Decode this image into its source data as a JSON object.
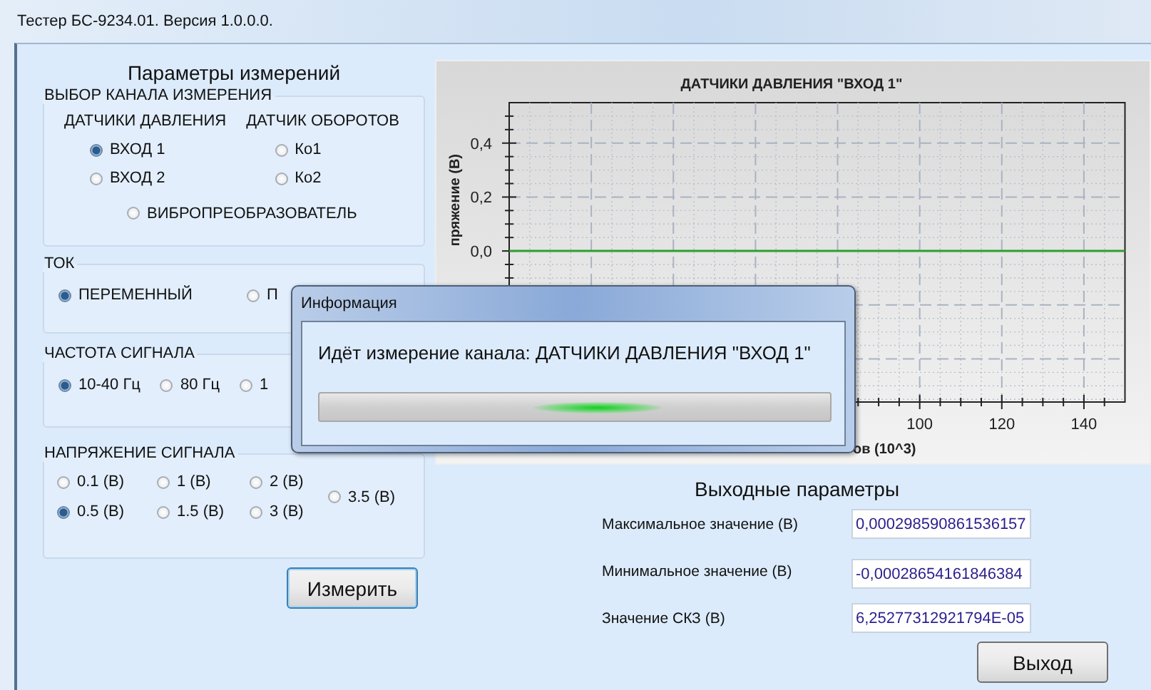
{
  "window": {
    "title": "Тестер БС-9234.01. Версия 1.0.0.0."
  },
  "parameters": {
    "heading": "Параметры измерений",
    "channel": {
      "legend": "ВЫБОР КАНАЛА ИЗМЕРЕНИЯ",
      "columns": [
        {
          "heading": "ДАТЧИКИ ДАВЛЕНИЯ",
          "options": [
            {
              "label": "ВХОД 1",
              "selected": true
            },
            {
              "label": "ВХОД 2",
              "selected": false
            }
          ]
        },
        {
          "heading": "ДАТЧИК ОБОРОТОВ",
          "options": [
            {
              "label": "Ко1",
              "selected": false
            },
            {
              "label": "Ко2",
              "selected": false
            }
          ]
        }
      ],
      "extra": {
        "label": "ВИБРОПРЕОБРАЗОВАТЕЛЬ",
        "selected": false
      }
    },
    "current": {
      "legend": "ТОК",
      "options": [
        {
          "label": "ПЕРЕМЕННЫЙ",
          "selected": true
        },
        {
          "label": "П",
          "selected": false
        }
      ]
    },
    "frequency": {
      "legend": "ЧАСТОТА СИГНАЛА",
      "options": [
        {
          "label": "10-40 Гц",
          "selected": true
        },
        {
          "label": "80 Гц",
          "selected": false
        },
        {
          "label": "1",
          "selected": false
        }
      ]
    },
    "voltage": {
      "legend": "НАПРЯЖЕНИЕ СИГНАЛА",
      "options": [
        {
          "label": "0.1 (В)",
          "selected": false
        },
        {
          "label": "1 (В)",
          "selected": false
        },
        {
          "label": "2 (В)",
          "selected": false
        },
        {
          "label": "3.5 (В)",
          "selected": false
        },
        {
          "label": "0.5 (В)",
          "selected": true
        },
        {
          "label": "1.5 (В)",
          "selected": false
        },
        {
          "label": "3 (В)",
          "selected": false
        }
      ]
    },
    "measure_button": "Измерить"
  },
  "chart": {
    "chart_data": {
      "type": "line",
      "title": "ДАТЧИКИ ДАВЛЕНИЯ \"ВХОД 1\"",
      "xlabel": "ов (10^3)",
      "ylabel": "пряжение (В)",
      "x": [
        0,
        150
      ],
      "series": [
        {
          "color": "#2ca02c",
          "values": [
            0,
            0
          ]
        }
      ],
      "grid": true,
      "xlim": [
        0,
        150
      ],
      "ylim": [
        -0.56,
        0.55
      ],
      "xticks": [
        100,
        120,
        140
      ],
      "yticks": [
        {
          "value": 0,
          "label": "0,0"
        },
        {
          "value": 0.2,
          "label": "0,2"
        },
        {
          "value": 0.4,
          "label": "0,4"
        }
      ]
    }
  },
  "output": {
    "heading": "Выходные параметры",
    "fields": [
      {
        "label": "Максимальное значение (В)",
        "value": "0,000298590861536157"
      },
      {
        "label": "Минимальное значение (В)",
        "value": "-0,00028654161846384"
      },
      {
        "label": "Значение СКЗ (В)",
        "value": "6,25277312921794E-05"
      }
    ],
    "exit_button": "Выход"
  },
  "dialog": {
    "title": "Информация",
    "message": "Идёт измерение канала: ДАТЧИКИ ДАВЛЕНИЯ \"ВХОД 1\"",
    "progress": {
      "marquee": true
    }
  }
}
